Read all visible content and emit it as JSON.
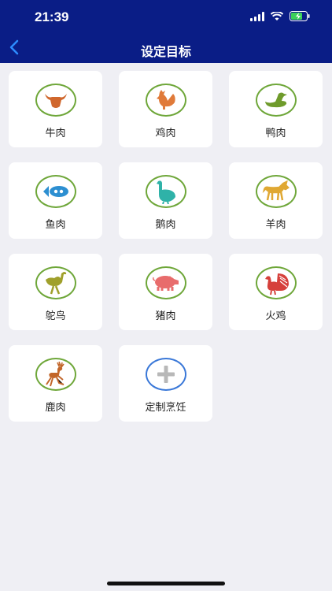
{
  "status": {
    "time": "21:39"
  },
  "header": {
    "title": "设定目标"
  },
  "targets": [
    {
      "label": "牛肉",
      "icon": "cow-icon",
      "color": "#d0672d"
    },
    {
      "label": "鸡肉",
      "icon": "rooster-icon",
      "color": "#e07a39"
    },
    {
      "label": "鸭肉",
      "icon": "duck-icon",
      "color": "#6f9b2b"
    },
    {
      "label": "鱼肉",
      "icon": "fish-icon",
      "color": "#2d8fd1"
    },
    {
      "label": "鹅肉",
      "icon": "goose-icon",
      "color": "#2fb2a8"
    },
    {
      "label": "羊肉",
      "icon": "goat-icon",
      "color": "#e0a833"
    },
    {
      "label": "鸵鸟",
      "icon": "ostrich-icon",
      "color": "#a0a02b"
    },
    {
      "label": "猪肉",
      "icon": "pig-icon",
      "color": "#e86c6c"
    },
    {
      "label": "火鸡",
      "icon": "turkey-icon",
      "color": "#d6403b"
    },
    {
      "label": "鹿肉",
      "icon": "deer-icon",
      "color": "#c2662a"
    },
    {
      "label": "定制烹饪",
      "icon": "plus-icon",
      "color": "#b8b8b8"
    }
  ]
}
